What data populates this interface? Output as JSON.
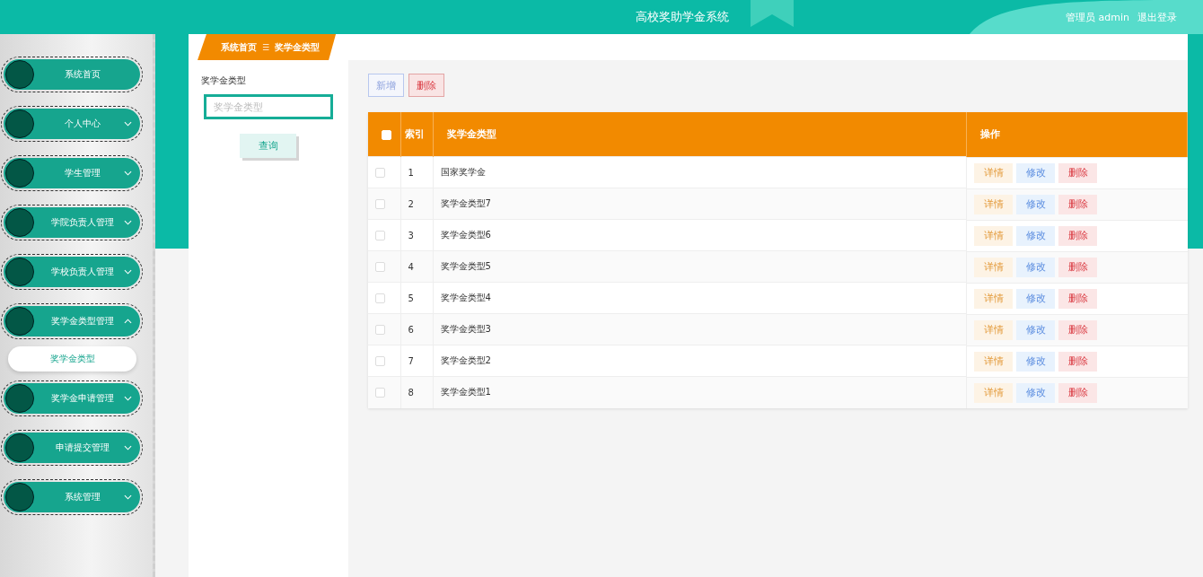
{
  "header": {
    "title": "高校奖助学金系统",
    "user": "管理员 admin",
    "logout": "退出登录"
  },
  "breadcrumb": [
    "系统首页",
    "奖学金类型"
  ],
  "breadcrumb_separator": "☰",
  "sidebar": {
    "items": [
      {
        "label": "系统首页",
        "kind": "link"
      },
      {
        "label": "个人中心",
        "kind": "group",
        "expanded": false
      },
      {
        "label": "学生管理",
        "kind": "group",
        "expanded": false
      },
      {
        "label": "学院负责人管理",
        "kind": "group",
        "expanded": false
      },
      {
        "label": "学校负责人管理",
        "kind": "group",
        "expanded": false
      },
      {
        "label": "奖学金类型管理",
        "kind": "group",
        "expanded": true,
        "children": [
          {
            "label": "奖学金类型",
            "selected": true
          }
        ]
      },
      {
        "label": "奖学金申请管理",
        "kind": "group",
        "expanded": false
      },
      {
        "label": "申请提交管理",
        "kind": "group",
        "expanded": false
      },
      {
        "label": "系统管理",
        "kind": "group",
        "expanded": false
      }
    ]
  },
  "filter": {
    "label": "奖学金类型",
    "placeholder": "奖学金类型",
    "button": "查询"
  },
  "toolbar": [
    {
      "label": "新增",
      "kind": "add"
    },
    {
      "label": "删除",
      "kind": "delete"
    }
  ],
  "table": {
    "select_all_checked": false,
    "columns": [
      "索引",
      "奖学金类型",
      "操作"
    ],
    "rows": [
      {
        "checked": false,
        "index": "1",
        "name": "国家奖学金",
        "actions": [
          "详情",
          "修改",
          "删除"
        ]
      },
      {
        "checked": false,
        "index": "2",
        "name": "奖学金类型7",
        "actions": [
          "详情",
          "修改",
          "删除"
        ]
      },
      {
        "checked": false,
        "index": "3",
        "name": "奖学金类型6",
        "actions": [
          "详情",
          "修改",
          "删除"
        ]
      },
      {
        "checked": false,
        "index": "4",
        "name": "奖学金类型5",
        "actions": [
          "详情",
          "修改",
          "删除"
        ]
      },
      {
        "checked": false,
        "index": "5",
        "name": "奖学金类型4",
        "actions": [
          "详情",
          "修改",
          "删除"
        ]
      },
      {
        "checked": false,
        "index": "6",
        "name": "奖学金类型3",
        "actions": [
          "详情",
          "修改",
          "删除"
        ]
      },
      {
        "checked": false,
        "index": "7",
        "name": "奖学金类型2",
        "actions": [
          "详情",
          "修改",
          "删除"
        ]
      },
      {
        "checked": false,
        "index": "8",
        "name": "奖学金类型1",
        "actions": [
          "详情",
          "修改",
          "删除"
        ]
      }
    ]
  }
}
